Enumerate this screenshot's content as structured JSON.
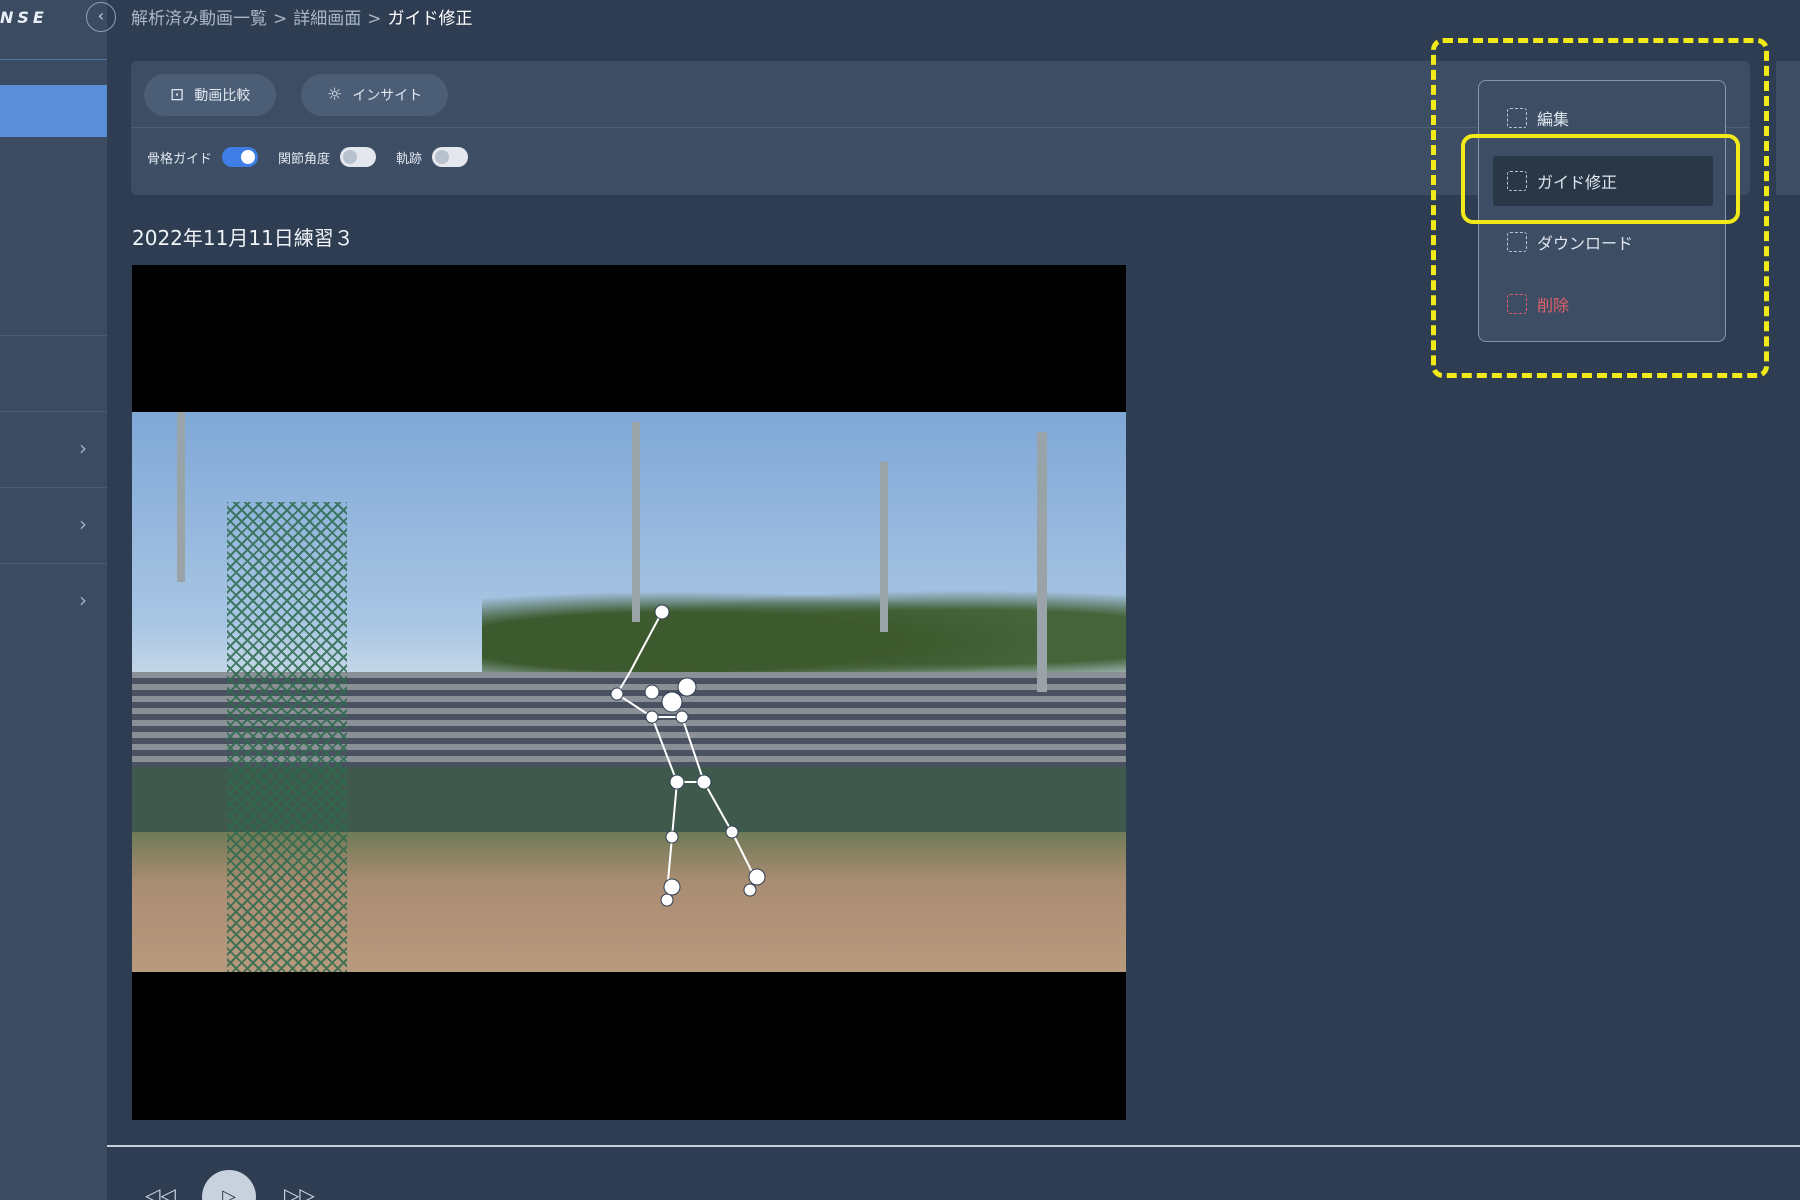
{
  "app": {
    "logo": "NSE"
  },
  "breadcrumb": {
    "items": [
      "解析済み動画一覧",
      "詳細画面"
    ],
    "separator": ">",
    "current": "ガイド修正"
  },
  "sidebar": {
    "items": [
      {
        "label": "",
        "active": true
      },
      {
        "label": ""
      },
      {
        "label": ""
      },
      {
        "label": ""
      },
      {
        "label": ""
      },
      {
        "label": ""
      }
    ],
    "chevron": "›"
  },
  "toolbar": {
    "compare_label": "動画比較",
    "compare_icon": "compare-icon",
    "insight_label": "インサイト",
    "insight_icon": "lightbulb-icon",
    "toggles": [
      {
        "label": "骨格ガイド",
        "on": true
      },
      {
        "label": "関節角度",
        "on": false
      },
      {
        "label": "軌跡",
        "on": false
      }
    ]
  },
  "video": {
    "title": "2022年11月11日練習３"
  },
  "player": {
    "rewind_icon": "rewind-icon",
    "play_icon": "play-icon",
    "forward_icon": "forward-icon"
  },
  "menu": {
    "items": [
      {
        "label": "編集"
      },
      {
        "label": "ガイド修正",
        "selected": true
      },
      {
        "label": "ダウンロード"
      },
      {
        "label": "削除",
        "danger": true
      }
    ]
  },
  "colors": {
    "accent": "#5a8fd8",
    "toggle_on": "#3f7ee6",
    "danger": "#e0616a",
    "highlight": "#f2ea18"
  }
}
